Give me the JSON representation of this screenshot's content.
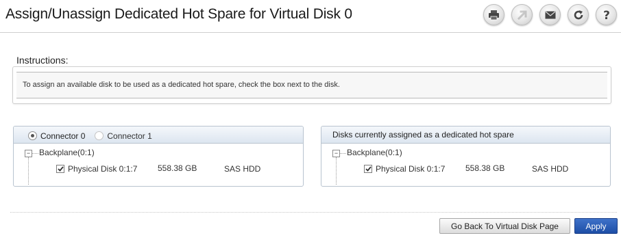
{
  "page": {
    "title": "Assign/Unassign Dedicated Hot Spare for Virtual Disk 0"
  },
  "toolbar": {
    "buttons": [
      {
        "name": "print",
        "icon": "printer-icon",
        "enabled": true
      },
      {
        "name": "export",
        "icon": "arrow-up-right-icon",
        "enabled": false
      },
      {
        "name": "email",
        "icon": "envelope-icon",
        "enabled": true
      },
      {
        "name": "refresh",
        "icon": "refresh-icon",
        "enabled": true
      },
      {
        "name": "help",
        "icon": "help-icon",
        "enabled": true
      }
    ]
  },
  "instructions": {
    "heading": "Instructions:",
    "text": "To assign an available disk to be used as a dedicated hot spare, check the box next to the disk."
  },
  "left_panel": {
    "connectors": [
      {
        "label": "Connector 0",
        "selected": true,
        "enabled": true
      },
      {
        "label": "Connector 1",
        "selected": false,
        "enabled": false
      }
    ],
    "tree": {
      "node": "Backplane(0:1)",
      "disks": [
        {
          "name": "Physical Disk 0:1:7",
          "size": "558.38 GB",
          "type": "SAS HDD",
          "checked": true
        }
      ]
    }
  },
  "right_panel": {
    "header": "Disks currently assigned as a dedicated hot spare",
    "tree": {
      "node": "Backplane(0:1)",
      "disks": [
        {
          "name": "Physical Disk 0:1:7",
          "size": "558.38 GB",
          "type": "SAS HDD",
          "checked": true
        }
      ]
    }
  },
  "footer": {
    "back_label": "Go Back To Virtual Disk Page",
    "apply_label": "Apply"
  },
  "colors": {
    "accent_button": "#1d4ea6",
    "panel_header": "#dde6f0",
    "panel_border": "#b8c3cf"
  }
}
